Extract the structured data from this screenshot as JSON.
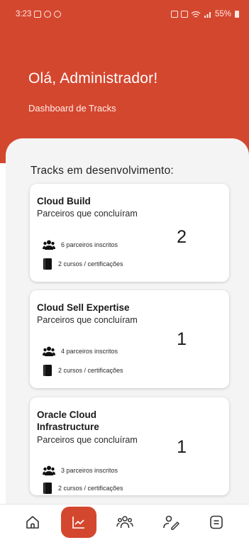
{
  "status_bar": {
    "time": "3:23",
    "battery": "55%"
  },
  "header": {
    "greeting": "Olá, Administrador!",
    "subtitle": "Dashboard de Tracks",
    "background_color": "#d4472f"
  },
  "section": {
    "title": "Tracks em desenvolvimento:"
  },
  "tracks": [
    {
      "title": "Cloud Build",
      "subtitle": "Parceiros que concluíram",
      "completed_count": "2",
      "partners_enrolled": "6 parceiros inscritos",
      "courses": "2 cursos / certificações"
    },
    {
      "title": "Cloud Sell Expertise",
      "subtitle": "Parceiros que concluíram",
      "completed_count": "1",
      "partners_enrolled": "4 parceiros inscritos",
      "courses": "2 cursos / certificações"
    },
    {
      "title": "Oracle Cloud Infrastructure",
      "subtitle": "Parceiros que concluíram",
      "completed_count": "1",
      "partners_enrolled": "3 parceiros inscritos",
      "courses": "2 cursos / certificações"
    }
  ],
  "bottom_nav": {
    "items": [
      {
        "icon": "home-icon",
        "active": false
      },
      {
        "icon": "chart-icon",
        "active": true
      },
      {
        "icon": "users-icon",
        "active": false
      },
      {
        "icon": "user-edit-icon",
        "active": false
      },
      {
        "icon": "document-icon",
        "active": false
      }
    ],
    "active_color": "#d4472f"
  }
}
